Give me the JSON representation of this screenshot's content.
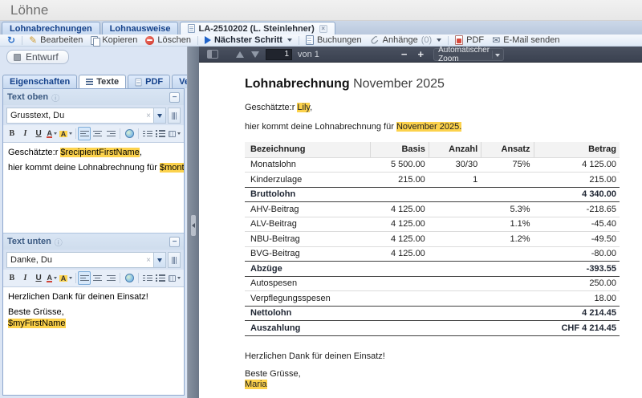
{
  "app": {
    "title": "Löhne"
  },
  "colors": {
    "accent": "#15428b",
    "highlight": "#fcd24c",
    "pdf_toolbar": "#3e4654",
    "delete_red": "#cc2e24"
  },
  "tabs": [
    {
      "label": "Lohnabrechnungen",
      "active": false
    },
    {
      "label": "Lohnausweise",
      "active": false
    },
    {
      "label": "LA-2510202 (L. Steinlehner)",
      "active": true
    }
  ],
  "toolbar": {
    "bearbeiten": "Bearbeiten",
    "kopieren": "Kopieren",
    "loeschen": "Löschen",
    "naechster_schritt": "Nächster Schritt",
    "buchungen": "Buchungen",
    "anhaenge": "Anhänge",
    "anhaenge_count": "(0)",
    "pdf": "PDF",
    "email": "E-Mail senden"
  },
  "sidebar": {
    "status_label": "Entwurf",
    "tabs": [
      {
        "label": "Eigenschaften",
        "active": false
      },
      {
        "label": "Texte",
        "active": true
      },
      {
        "label": "PDF",
        "active": false
      },
      {
        "label": "Verlauf",
        "active": false
      }
    ],
    "text_oben": {
      "title": "Text oben",
      "template_value": "Grusstext, Du",
      "lines": [
        [
          {
            "t": "Geschätzte:r "
          },
          {
            "t": "$recipientFirstName",
            "hl": true
          },
          {
            "t": ","
          }
        ],
        [],
        [
          {
            "t": "hier kommt deine Lohnabrechnung für "
          },
          {
            "t": "$monthYear.",
            "hl": true
          }
        ]
      ]
    },
    "text_unten": {
      "title": "Text unten",
      "template_value": "Danke, Du",
      "lines": [
        [
          {
            "t": "Herzlichen Dank für deinen Einsatz!"
          }
        ],
        [],
        [
          {
            "t": "Beste Grüsse,"
          }
        ],
        [
          {
            "t": "$myFirstName",
            "hl": true
          }
        ]
      ]
    }
  },
  "pdf_viewer": {
    "page": "1",
    "page_suffix": "von 1",
    "zoom_label": "Automatischer Zoom"
  },
  "document": {
    "title_bold": "Lohnabrechnung",
    "title_rest": " November 2025",
    "paragraphs": [
      [
        {
          "t": "Geschätzte:r "
        },
        {
          "t": "Lily",
          "hl": true
        },
        {
          "t": ","
        }
      ],
      [
        {
          "t": "hier kommt deine Lohnabrechnung für "
        },
        {
          "t": "November 2025.",
          "hl": true
        }
      ]
    ],
    "table": {
      "headers": [
        "Bezeichnung",
        "Basis",
        "Anzahl",
        "Ansatz",
        "Betrag"
      ],
      "rows": [
        {
          "cells": [
            "Monatslohn",
            "5 500.00",
            "30/30",
            "75%",
            "4 125.00"
          ],
          "bold": false
        },
        {
          "cells": [
            "Kinderzulage",
            "215.00",
            "1",
            "",
            "215.00"
          ],
          "bold": false
        },
        {
          "cells": [
            "Bruttolohn",
            "",
            "",
            "",
            "4 340.00"
          ],
          "bold": true
        },
        {
          "cells": [
            "AHV-Beitrag",
            "4 125.00",
            "",
            "5.3%",
            "-218.65"
          ],
          "bold": false
        },
        {
          "cells": [
            "ALV-Beitrag",
            "4 125.00",
            "",
            "1.1%",
            "-45.40"
          ],
          "bold": false
        },
        {
          "cells": [
            "NBU-Beitrag",
            "4 125.00",
            "",
            "1.2%",
            "-49.50"
          ],
          "bold": false
        },
        {
          "cells": [
            "BVG-Beitrag",
            "4 125.00",
            "",
            "",
            "-80.00"
          ],
          "bold": false
        },
        {
          "cells": [
            "Abzüge",
            "",
            "",
            "",
            "-393.55"
          ],
          "bold": true
        },
        {
          "cells": [
            "Autospesen",
            "",
            "",
            "",
            "250.00"
          ],
          "bold": false
        },
        {
          "cells": [
            "Verpflegungsspesen",
            "",
            "",
            "",
            "18.00"
          ],
          "bold": false
        },
        {
          "cells": [
            "Nettolohn",
            "",
            "",
            "",
            "4 214.45"
          ],
          "bold": true
        },
        {
          "cells": [
            "Auszahlung",
            "",
            "",
            "",
            "CHF 4 214.45"
          ],
          "bold": true
        }
      ]
    },
    "footer_lines": [
      [
        {
          "t": "Herzlichen Dank für deinen Einsatz!"
        }
      ],
      [],
      [
        {
          "t": "Beste Grüsse,"
        }
      ],
      [
        {
          "t": "Maria",
          "hl": true
        }
      ]
    ]
  }
}
